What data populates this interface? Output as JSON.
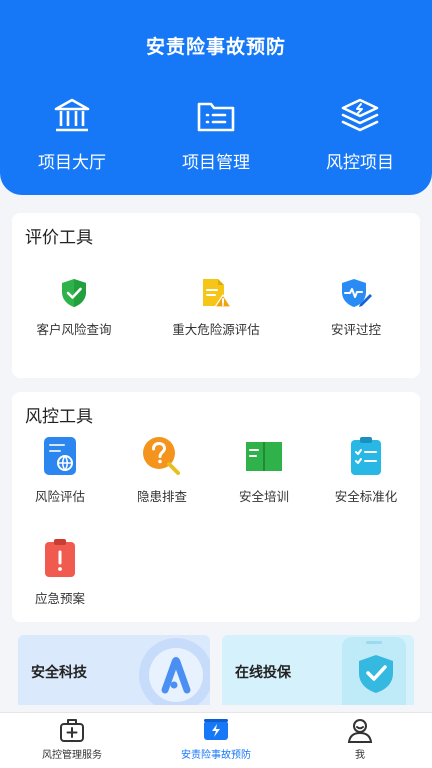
{
  "header": {
    "title": "安责险事故预防",
    "nav": [
      {
        "label": "项目大厅",
        "icon": "bank-building-icon"
      },
      {
        "label": "项目管理",
        "icon": "folder-list-icon"
      },
      {
        "label": "风控项目",
        "icon": "layers-flash-icon"
      }
    ]
  },
  "evaluation_tools": {
    "title": "评价工具",
    "items": [
      {
        "label": "客户风险查询",
        "icon": "shield-check-icon"
      },
      {
        "label": "重大危险源评估",
        "icon": "document-warning-icon"
      },
      {
        "label": "安评过控",
        "icon": "shield-pulse-icon"
      }
    ]
  },
  "risk_tools": {
    "title": "风控工具",
    "items": [
      {
        "label": "风险评估",
        "icon": "document-globe-icon"
      },
      {
        "label": "隐患排查",
        "icon": "question-search-icon"
      },
      {
        "label": "安全培训",
        "icon": "open-book-icon"
      },
      {
        "label": "安全标准化",
        "icon": "clipboard-checklist-icon"
      },
      {
        "label": "应急预案",
        "icon": "clipboard-alert-icon"
      }
    ]
  },
  "banners": [
    {
      "label": "安全科技",
      "icon": "tech-logo-icon"
    },
    {
      "label": "在线投保",
      "icon": "phone-shield-icon"
    }
  ],
  "tabbar": {
    "items": [
      {
        "label": "风控管理服务",
        "icon": "medical-kit-icon",
        "active": false
      },
      {
        "label": "安责险事故预防",
        "icon": "flash-card-icon",
        "active": true
      },
      {
        "label": "我",
        "icon": "user-icon",
        "active": false
      }
    ]
  },
  "colors": {
    "primary": "#1677f7",
    "warning": "#f5c518",
    "danger": "#f05a4f",
    "success": "#28b34a"
  }
}
